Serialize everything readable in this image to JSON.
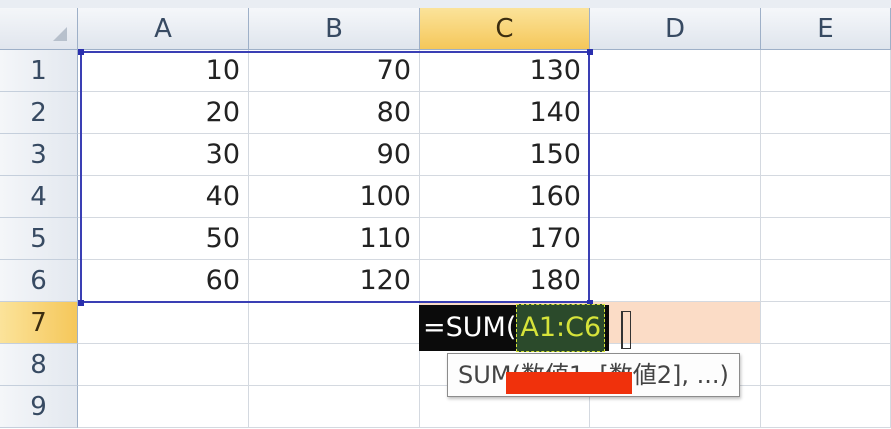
{
  "columns": [
    "A",
    "B",
    "C",
    "D",
    "E"
  ],
  "rows": [
    "1",
    "2",
    "3",
    "4",
    "5",
    "6",
    "7",
    "8",
    "9"
  ],
  "cells": {
    "A": [
      "10",
      "20",
      "30",
      "40",
      "50",
      "60"
    ],
    "B": [
      "70",
      "80",
      "90",
      "100",
      "110",
      "120"
    ],
    "C": [
      "130",
      "140",
      "150",
      "160",
      "170",
      "180"
    ]
  },
  "selected_column": "C",
  "selected_row": "7",
  "formula_editor": {
    "prefix": "=SUM(",
    "reference": "A1:C6"
  },
  "tooltip": {
    "text": "SUM(数値1, [数値2], ...)"
  },
  "colors": {
    "range_border": "#3a3fb4",
    "selected_header": "#f5c75a",
    "highlight_fill": "#fbdcc6",
    "redaction": "#f0310c"
  }
}
